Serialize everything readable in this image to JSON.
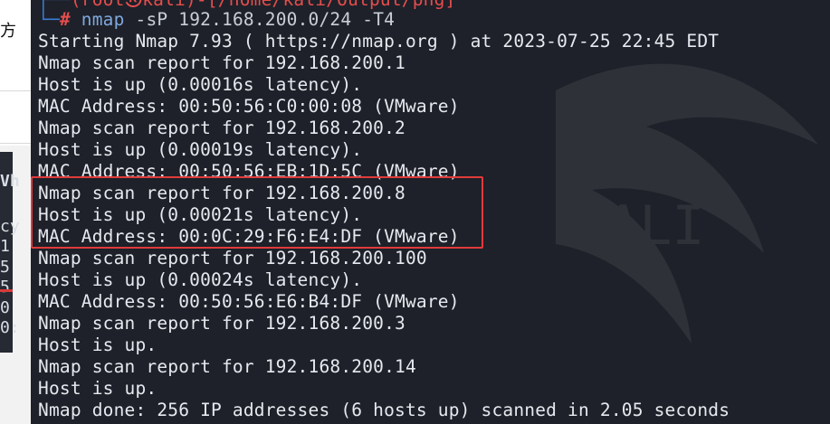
{
  "left_panel": {
    "fragments": [
      "方",
      "Vh",
      "cy",
      "1",
      "5",
      "5",
      "0",
      "0:"
    ]
  },
  "terminal": {
    "prompt_path_partial": "(root㉿kali)-[/home/kali/Output/png]",
    "prompt_symbol": "#",
    "command": "nmap",
    "command_args": "-sP 192.168.200.0/24 -T4",
    "lines": [
      "Starting Nmap 7.93 ( https://nmap.org ) at 2023-07-25 22:45 EDT",
      "Nmap scan report for 192.168.200.1",
      "Host is up (0.00016s latency).",
      "MAC Address: 00:50:56:C0:00:08 (VMware)",
      "Nmap scan report for 192.168.200.2",
      "Host is up (0.00019s latency).",
      "MAC Address: 00:50:56:EB:1D:5C (VMware)",
      "Nmap scan report for 192.168.200.8",
      "Host is up (0.00021s latency).",
      "MAC Address: 00:0C:29:F6:E4:DF (VMware)",
      "Nmap scan report for 192.168.200.100",
      "Host is up (0.00024s latency).",
      "MAC Address: 00:50:56:E6:B4:DF (VMware)",
      "Nmap scan report for 192.168.200.3",
      "Host is up.",
      "Nmap scan report for 192.168.200.14",
      "Host is up.",
      "Nmap done: 256 IP addresses (6 hosts up) scanned in 2.05 seconds"
    ]
  },
  "colors": {
    "terminal_bg": "#1e2129",
    "text": "#e6e9ee",
    "prompt_blue": "#3a7bd5",
    "prompt_red": "#e64d4d",
    "highlight_red": "#e03b3b"
  }
}
